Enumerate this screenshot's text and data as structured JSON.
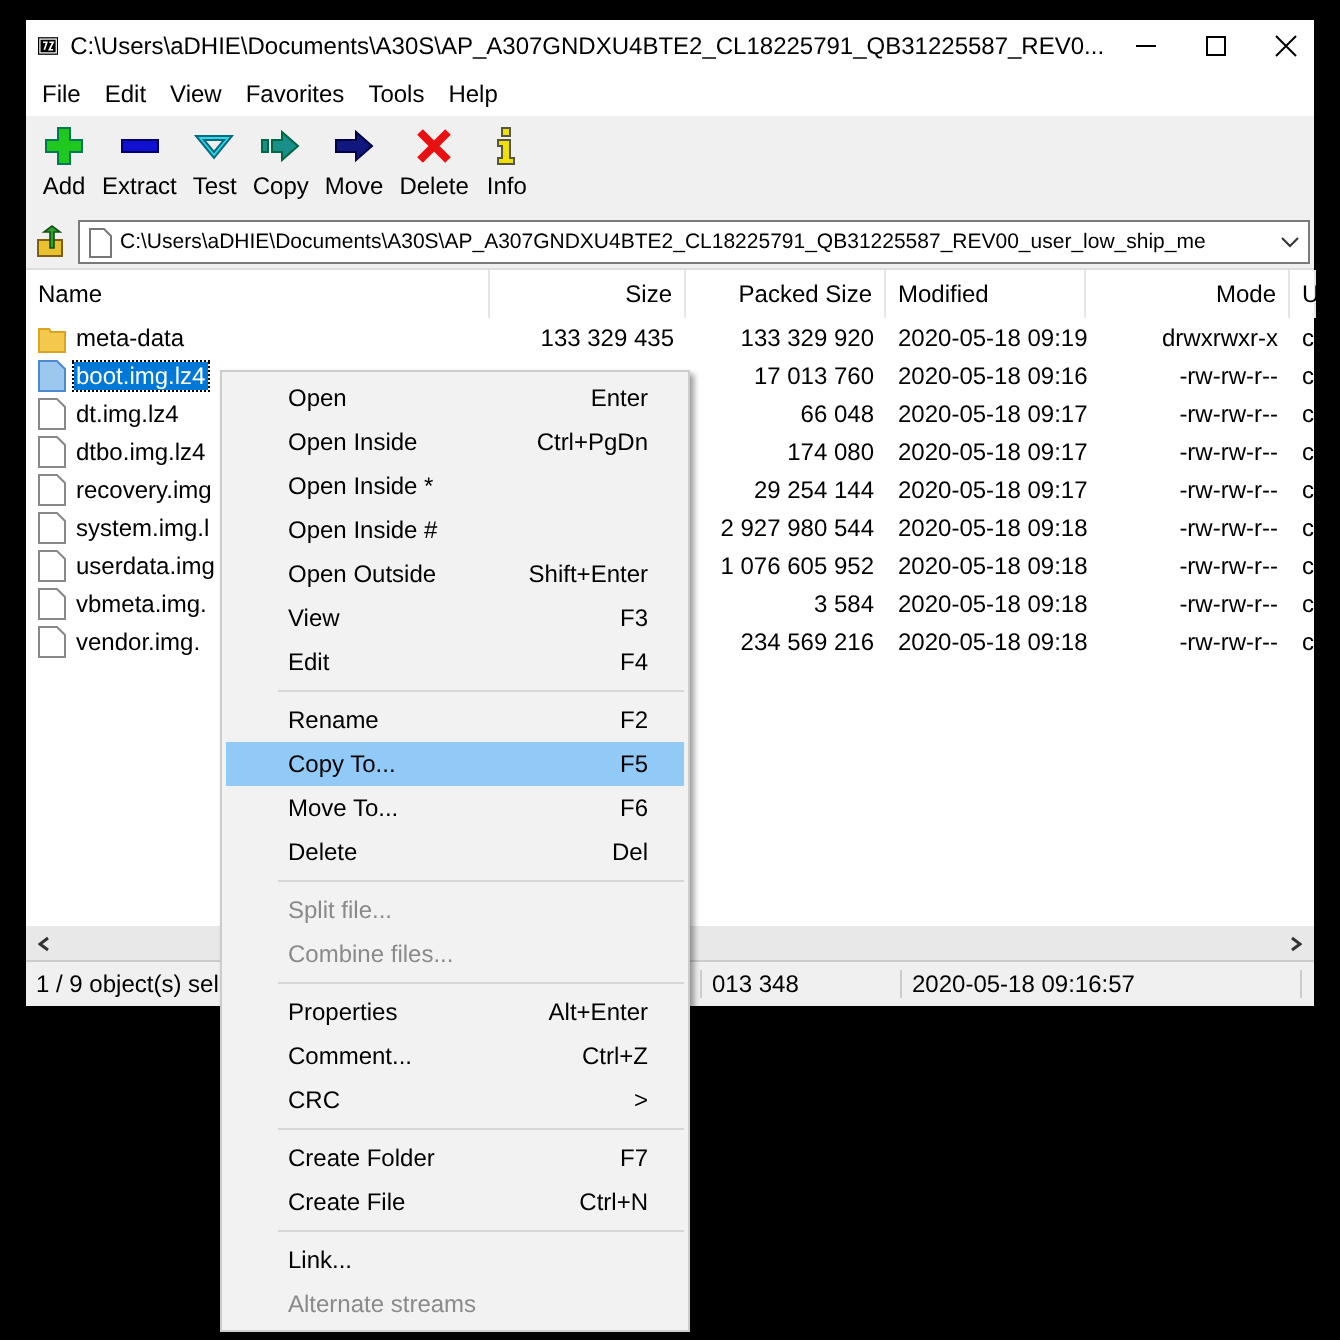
{
  "window": {
    "title": "C:\\Users\\aDHIE\\Documents\\A30S\\AP_A307GNDXU4BTE2_CL18225791_QB31225587_REV0..."
  },
  "menu_bar": [
    "File",
    "Edit",
    "View",
    "Favorites",
    "Tools",
    "Help"
  ],
  "toolbar": [
    {
      "kind": "add",
      "label": "Add"
    },
    {
      "kind": "extract",
      "label": "Extract"
    },
    {
      "kind": "test",
      "label": "Test"
    },
    {
      "kind": "copy",
      "label": "Copy"
    },
    {
      "kind": "move",
      "label": "Move"
    },
    {
      "kind": "delete",
      "label": "Delete"
    },
    {
      "kind": "info",
      "label": "Info"
    }
  ],
  "address_bar": {
    "value": "C:\\Users\\aDHIE\\Documents\\A30S\\AP_A307GNDXU4BTE2_CL18225791_QB31225587_REV00_user_low_ship_me"
  },
  "table": {
    "columns": [
      "Name",
      "Size",
      "Packed Size",
      "Modified",
      "Mode",
      "U"
    ],
    "rows": [
      {
        "kind": "folder",
        "selected": false,
        "cells": [
          "meta-data",
          "133 329 435",
          "133 329 920",
          "2020-05-18 09:19",
          "drwxrwxr-x",
          "c"
        ]
      },
      {
        "kind": "file",
        "selected": true,
        "cells": [
          "boot.img.lz4",
          "",
          "17 013 760",
          "2020-05-18 09:16",
          "-rw-rw-r--",
          "c"
        ]
      },
      {
        "kind": "file",
        "selected": false,
        "cells": [
          "dt.img.lz4",
          "",
          "66 048",
          "2020-05-18 09:17",
          "-rw-rw-r--",
          "c"
        ]
      },
      {
        "kind": "file",
        "selected": false,
        "cells": [
          "dtbo.img.lz4",
          "",
          "174 080",
          "2020-05-18 09:17",
          "-rw-rw-r--",
          "c"
        ]
      },
      {
        "kind": "file",
        "selected": false,
        "cells": [
          "recovery.img",
          "",
          "29 254 144",
          "2020-05-18 09:17",
          "-rw-rw-r--",
          "c"
        ]
      },
      {
        "kind": "file",
        "selected": false,
        "cells": [
          "system.img.l",
          "",
          "2 927 980 544",
          "2020-05-18 09:18",
          "-rw-rw-r--",
          "c"
        ]
      },
      {
        "kind": "file",
        "selected": false,
        "cells": [
          "userdata.img",
          "",
          "1 076 605 952",
          "2020-05-18 09:18",
          "-rw-rw-r--",
          "c"
        ]
      },
      {
        "kind": "file",
        "selected": false,
        "cells": [
          "vbmeta.img.",
          "",
          "3 584",
          "2020-05-18 09:18",
          "-rw-rw-r--",
          "c"
        ]
      },
      {
        "kind": "file",
        "selected": false,
        "cells": [
          "vendor.img.",
          "",
          "234 569 216",
          "2020-05-18 09:18",
          "-rw-rw-r--",
          "c"
        ]
      }
    ]
  },
  "status_bar": [
    "1 / 9 object(s) sel",
    "013 348",
    "2020-05-18 09:16:57"
  ],
  "context_menu": [
    {
      "kind": "item",
      "label": "Open",
      "shortcut": "Enter",
      "selected": false,
      "disabled": false
    },
    {
      "kind": "item",
      "label": "Open Inside",
      "shortcut": "Ctrl+PgDn",
      "selected": false,
      "disabled": false
    },
    {
      "kind": "item",
      "label": "Open Inside *",
      "selected": false,
      "disabled": false
    },
    {
      "kind": "item",
      "label": "Open Inside #",
      "selected": false,
      "disabled": false
    },
    {
      "kind": "item",
      "label": "Open Outside",
      "shortcut": "Shift+Enter",
      "selected": false,
      "disabled": false
    },
    {
      "kind": "item",
      "label": "View",
      "shortcut": "F3",
      "selected": false,
      "disabled": false
    },
    {
      "kind": "item",
      "label": "Edit",
      "shortcut": "F4",
      "selected": false,
      "disabled": false
    },
    {
      "kind": "separator"
    },
    {
      "kind": "item",
      "label": "Rename",
      "shortcut": "F2",
      "selected": false,
      "disabled": false
    },
    {
      "kind": "item",
      "label": "Copy To...",
      "shortcut": "F5",
      "selected": true,
      "disabled": false
    },
    {
      "kind": "item",
      "label": "Move To...",
      "shortcut": "F6",
      "selected": false,
      "disabled": false
    },
    {
      "kind": "item",
      "label": "Delete",
      "shortcut": "Del",
      "selected": false,
      "disabled": false
    },
    {
      "kind": "separator"
    },
    {
      "kind": "item",
      "label": "Split file...",
      "selected": false,
      "disabled": true
    },
    {
      "kind": "item",
      "label": "Combine files...",
      "selected": false,
      "disabled": true
    },
    {
      "kind": "separator"
    },
    {
      "kind": "item",
      "label": "Properties",
      "shortcut": "Alt+Enter",
      "selected": false,
      "disabled": false
    },
    {
      "kind": "item",
      "label": "Comment...",
      "shortcut": "Ctrl+Z",
      "selected": false,
      "disabled": false
    },
    {
      "kind": "item",
      "label": "CRC",
      "shortcut": ">",
      "selected": false,
      "disabled": false
    },
    {
      "kind": "separator"
    },
    {
      "kind": "item",
      "label": "Create Folder",
      "shortcut": "F7",
      "selected": false,
      "disabled": false
    },
    {
      "kind": "item",
      "label": "Create File",
      "shortcut": "Ctrl+N",
      "selected": false,
      "disabled": false
    },
    {
      "kind": "separator"
    },
    {
      "kind": "item",
      "label": "Link...",
      "selected": false,
      "disabled": false
    },
    {
      "kind": "item",
      "label": "Alternate streams",
      "selected": false,
      "disabled": true
    }
  ]
}
